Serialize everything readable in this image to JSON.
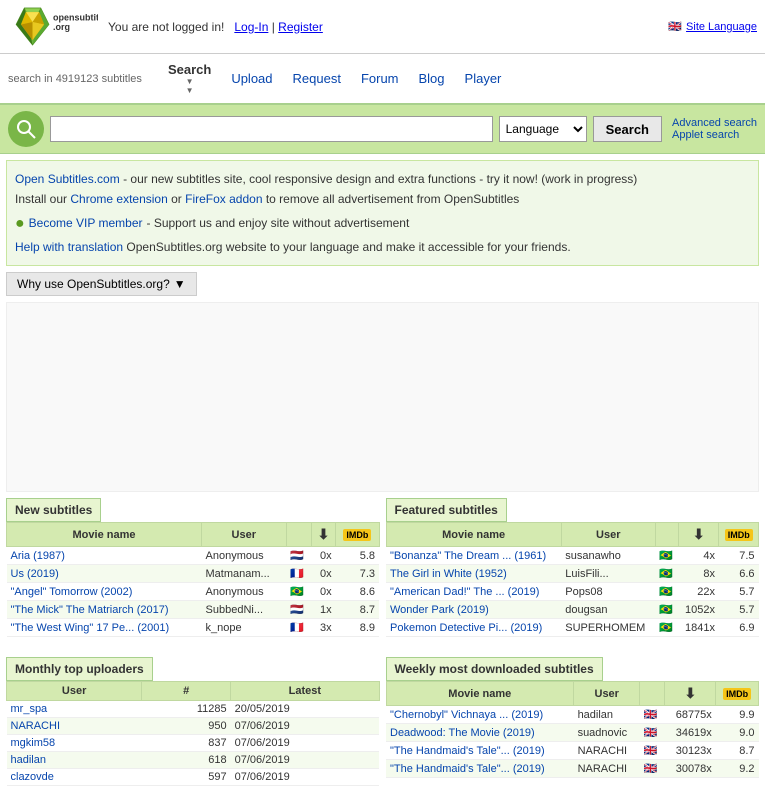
{
  "header": {
    "logo_text": "opensubtitles.org",
    "not_logged_in": "You are not logged in!",
    "login_label": "Log-In",
    "register_label": "Register",
    "site_language_label": "Site Language"
  },
  "nav": {
    "search_count": "search in 4919123 subtitles",
    "links": [
      {
        "label": "Search",
        "active": true
      },
      {
        "label": "Upload",
        "active": false
      },
      {
        "label": "Request",
        "active": false
      },
      {
        "label": "Forum",
        "active": false
      },
      {
        "label": "Blog",
        "active": false
      },
      {
        "label": "Player",
        "active": false
      }
    ]
  },
  "search_bar": {
    "placeholder": "",
    "language_default": "Language",
    "search_button": "Search",
    "advanced_search": "Advanced search",
    "applet_search": "Applet search"
  },
  "info": {
    "line1_prefix": "Open Subtitles.com",
    "line1_suffix": "- our new subtitles site, cool responsive design and extra functions - try it now! (work in progress)",
    "line2_prefix": "Install our",
    "chrome_ext": "Chrome extension",
    "or": "or",
    "firefox_addon": "FireFox addon",
    "line2_suffix": "to remove all advertisement from OpenSubtitles",
    "vip_prefix": "Become VIP member",
    "vip_suffix": "- Support us and enjoy site without advertisement",
    "translate_prefix": "Help with translation",
    "translate_suffix": "OpenSubtitles.org website to your language and make it accessible for your friends."
  },
  "why_use": {
    "label": "Why use OpenSubtitles.org?",
    "arrow": "▼"
  },
  "new_subtitles": {
    "header": "New subtitles",
    "col_movie": "Movie name",
    "col_user": "User",
    "rows": [
      {
        "movie": "Aria (1987)",
        "user": "Anonymous",
        "flag": "🇳🇱",
        "count": "0x",
        "rating": "5.8"
      },
      {
        "movie": "Us (2019)",
        "user": "Matmanam...",
        "flag": "🇫🇷",
        "count": "0x",
        "rating": "7.3"
      },
      {
        "movie": "\"Angel\" Tomorrow (2002)",
        "user": "Anonymous",
        "flag": "🇧🇷",
        "count": "0x",
        "rating": "8.6"
      },
      {
        "movie": "\"The Mick\" The Matriarch (2017)",
        "user": "SubbedNi...",
        "flag": "🇳🇱",
        "count": "1x",
        "rating": "8.7"
      },
      {
        "movie": "\"The West Wing\" 17 Pe... (2001)",
        "user": "k_nope",
        "flag": "🇫🇷",
        "count": "3x",
        "rating": "8.9"
      }
    ]
  },
  "featured_subtitles": {
    "header": "Featured subtitles",
    "col_movie": "Movie name",
    "col_user": "User",
    "rows": [
      {
        "movie": "\"Bonanza\" The Dream ... (1961)",
        "user": "susanawho",
        "flag": "🇧🇷",
        "count": "4x",
        "rating": "7.5"
      },
      {
        "movie": "The Girl in White (1952)",
        "user": "LuisFili...",
        "flag": "🇧🇷",
        "count": "8x",
        "rating": "6.6"
      },
      {
        "movie": "\"American Dad!\" The ... (2019)",
        "user": "Pops08",
        "flag": "🇧🇷",
        "count": "22x",
        "rating": "5.7"
      },
      {
        "movie": "Wonder Park (2019)",
        "user": "dougsan",
        "flag": "🇧🇷",
        "count": "1052x",
        "rating": "5.7"
      },
      {
        "movie": "Pokemon Detective Pi... (2019)",
        "user": "SUPERHOMEM",
        "flag": "🇧🇷",
        "count": "1841x",
        "rating": "6.9"
      }
    ]
  },
  "monthly_uploaders": {
    "header": "Monthly top uploaders",
    "col_user": "User",
    "col_count": "#",
    "col_latest": "Latest",
    "rows": [
      {
        "user": "mr_spa",
        "count": "11285",
        "latest": "20/05/2019"
      },
      {
        "user": "NARACHI",
        "count": "950",
        "latest": "07/06/2019"
      },
      {
        "user": "mgkim58",
        "count": "837",
        "latest": "07/06/2019"
      },
      {
        "user": "hadilan",
        "count": "618",
        "latest": "07/06/2019"
      },
      {
        "user": "clazovde",
        "count": "597",
        "latest": "07/06/2019"
      }
    ]
  },
  "weekly_downloaded": {
    "header": "Weekly most downloaded subtitles",
    "col_movie": "Movie name",
    "col_user": "User",
    "rows": [
      {
        "movie": "\"Chernobyl\" Vichnaya ... (2019)",
        "user": "hadilan",
        "flag": "🇬🇧",
        "count": "68775x",
        "rating": "9.9"
      },
      {
        "movie": "Deadwood: The Movie (2019)",
        "user": "suadnovic",
        "flag": "🇬🇧",
        "count": "34619x",
        "rating": "9.0"
      },
      {
        "movie": "\"The Handmaid's Tale\"... (2019)",
        "user": "NARACHI",
        "flag": "🇬🇧",
        "count": "30123x",
        "rating": "8.7"
      },
      {
        "movie": "\"The Handmaid's Tale\"... (2019)",
        "user": "NARACHI",
        "flag": "🇬🇧",
        "count": "30078x",
        "rating": "9.2"
      }
    ]
  }
}
